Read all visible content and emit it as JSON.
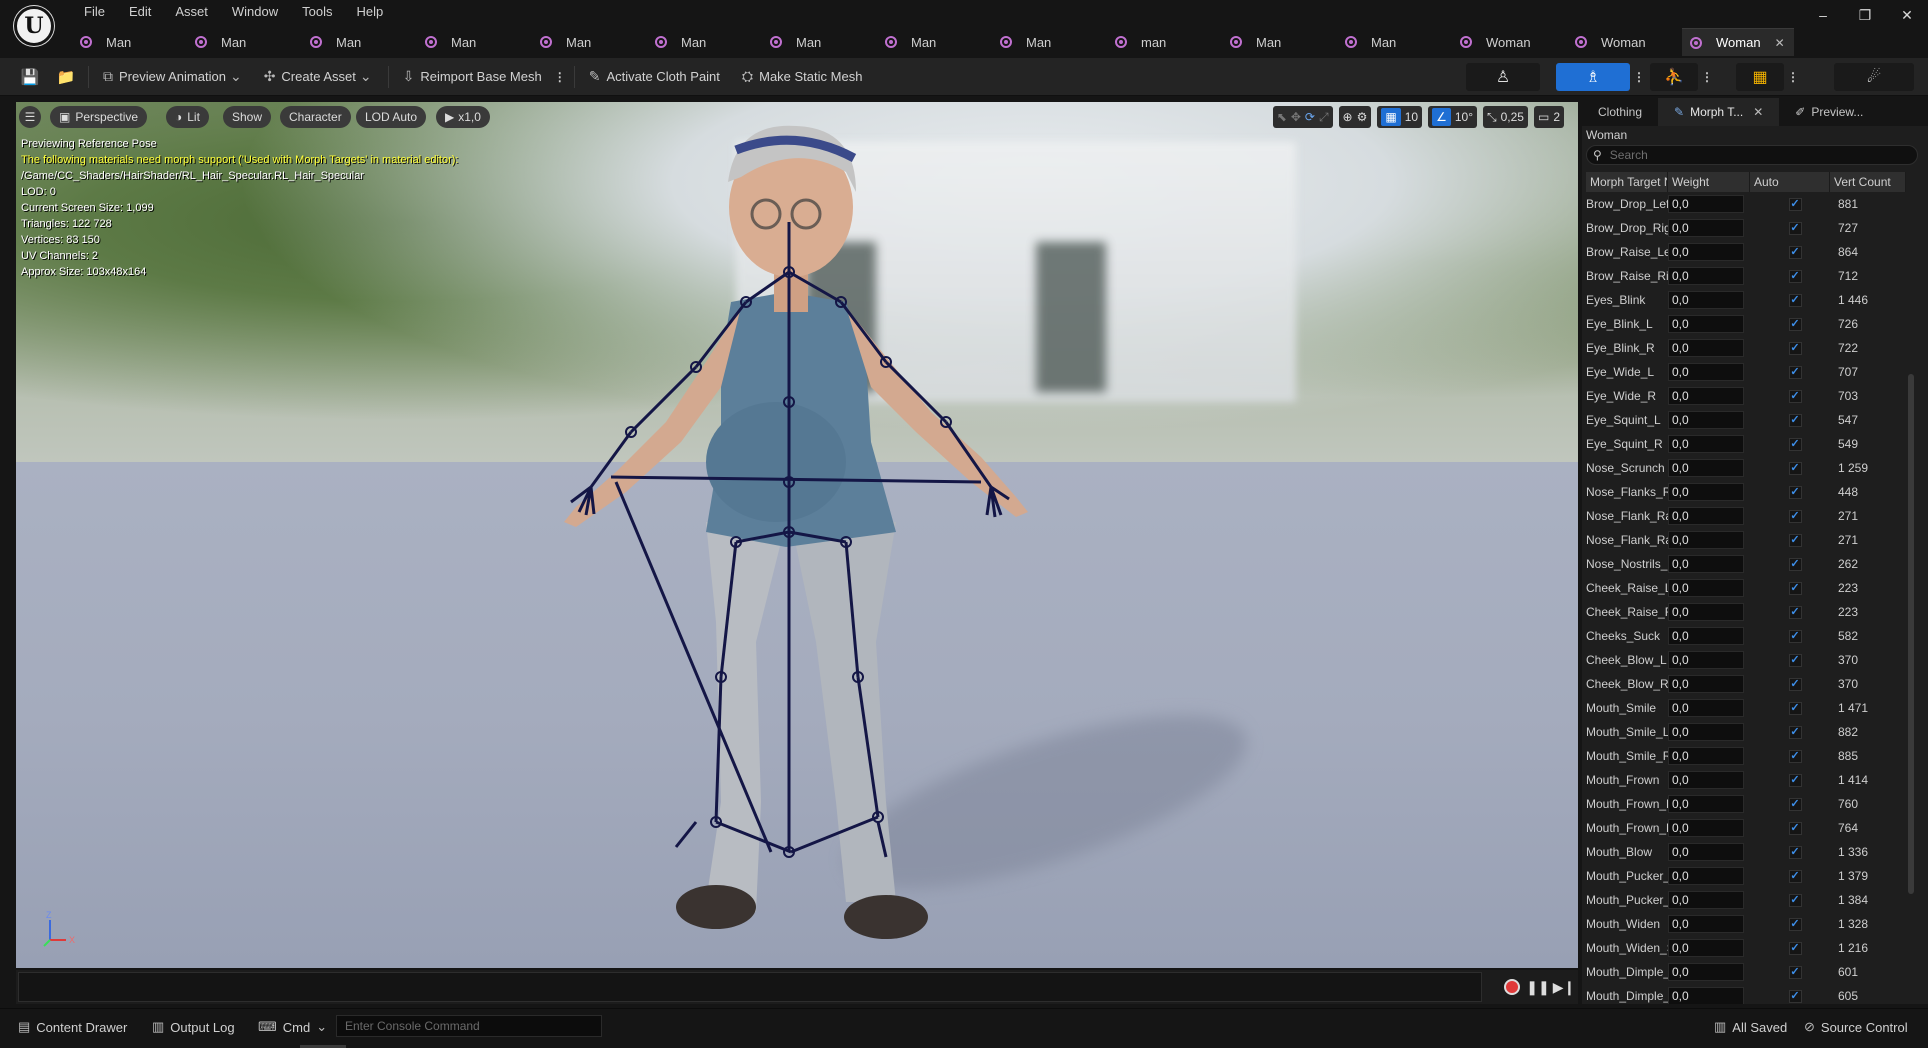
{
  "menu": [
    "File",
    "Edit",
    "Asset",
    "Window",
    "Tools",
    "Help"
  ],
  "window_controls": {
    "minimize": "–",
    "restore": "❐",
    "close": "✕"
  },
  "tabs": [
    {
      "label": "Man"
    },
    {
      "label": "Man"
    },
    {
      "label": "Man"
    },
    {
      "label": "Man"
    },
    {
      "label": "Man"
    },
    {
      "label": "Man"
    },
    {
      "label": "Man"
    },
    {
      "label": "Man"
    },
    {
      "label": "Man"
    },
    {
      "label": "man"
    },
    {
      "label": "Man"
    },
    {
      "label": "Man"
    },
    {
      "label": "Woman"
    },
    {
      "label": "Woman"
    },
    {
      "label": "Woman",
      "active": true
    }
  ],
  "toolbar": {
    "preview_animation": "Preview Animation",
    "create_asset": "Create Asset",
    "reimport": "Reimport Base Mesh",
    "cloth_paint": "Activate Cloth Paint",
    "static_mesh": "Make Static Mesh"
  },
  "viewport": {
    "perspective": "Perspective",
    "lit": "Lit",
    "show": "Show",
    "character": "Character",
    "lod": "LOD Auto",
    "speed": "x1,0",
    "grid_size": "10",
    "angle": "10°",
    "scale": "0,25",
    "camera_speed": "2",
    "info": {
      "line1": "Previewing Reference Pose",
      "warning": "The following materials need morph support ('Used with Morph Targets' in material editor):",
      "material": "/Game/CC_Shaders/HairShader/RL_Hair_Specular.RL_Hair_Specular",
      "lod": "LOD: 0",
      "screen_size": "Current Screen Size: 1,099",
      "triangles": "Triangles: 122 728",
      "vertices": "Vertices: 83 150",
      "uv": "UV Channels: 2",
      "approx": "Approx Size: 103x48x164"
    },
    "axis_z": "Z",
    "axis_x": "X"
  },
  "panel": {
    "tabs": {
      "clothing": "Clothing",
      "morph": "Morph T...",
      "preview": "Preview..."
    },
    "subject": "Woman",
    "search_placeholder": "Search",
    "columns": {
      "name": "Morph Target Name",
      "weight": "Weight",
      "auto": "Auto",
      "vert": "Vert Count"
    },
    "rows": [
      {
        "name": "Brow_Drop_Left",
        "weight": "0,0",
        "vert": "881"
      },
      {
        "name": "Brow_Drop_Right",
        "weight": "0,0",
        "vert": "727"
      },
      {
        "name": "Brow_Raise_Left",
        "weight": "0,0",
        "vert": "864"
      },
      {
        "name": "Brow_Raise_Right",
        "weight": "0,0",
        "vert": "712"
      },
      {
        "name": "Eyes_Blink",
        "weight": "0,0",
        "vert": "1 446"
      },
      {
        "name": "Eye_Blink_L",
        "weight": "0,0",
        "vert": "726"
      },
      {
        "name": "Eye_Blink_R",
        "weight": "0,0",
        "vert": "722"
      },
      {
        "name": "Eye_Wide_L",
        "weight": "0,0",
        "vert": "707"
      },
      {
        "name": "Eye_Wide_R",
        "weight": "0,0",
        "vert": "703"
      },
      {
        "name": "Eye_Squint_L",
        "weight": "0,0",
        "vert": "547"
      },
      {
        "name": "Eye_Squint_R",
        "weight": "0,0",
        "vert": "549"
      },
      {
        "name": "Nose_Scrunch",
        "weight": "0,0",
        "vert": "1 259"
      },
      {
        "name": "Nose_Flanks_Raise",
        "weight": "0,0",
        "vert": "448"
      },
      {
        "name": "Nose_Flank_Raise_L",
        "weight": "0,0",
        "vert": "271"
      },
      {
        "name": "Nose_Flank_Raise_R",
        "weight": "0,0",
        "vert": "271"
      },
      {
        "name": "Nose_Nostrils_Flare",
        "weight": "0,0",
        "vert": "262"
      },
      {
        "name": "Cheek_Raise_L",
        "weight": "0,0",
        "vert": "223"
      },
      {
        "name": "Cheek_Raise_R",
        "weight": "0,0",
        "vert": "223"
      },
      {
        "name": "Cheeks_Suck",
        "weight": "0,0",
        "vert": "582"
      },
      {
        "name": "Cheek_Blow_L",
        "weight": "0,0",
        "vert": "370"
      },
      {
        "name": "Cheek_Blow_R",
        "weight": "0,0",
        "vert": "370"
      },
      {
        "name": "Mouth_Smile",
        "weight": "0,0",
        "vert": "1 471"
      },
      {
        "name": "Mouth_Smile_L",
        "weight": "0,0",
        "vert": "882"
      },
      {
        "name": "Mouth_Smile_R",
        "weight": "0,0",
        "vert": "885"
      },
      {
        "name": "Mouth_Frown",
        "weight": "0,0",
        "vert": "1 414"
      },
      {
        "name": "Mouth_Frown_L",
        "weight": "0,0",
        "vert": "760"
      },
      {
        "name": "Mouth_Frown_R",
        "weight": "0,0",
        "vert": "764"
      },
      {
        "name": "Mouth_Blow",
        "weight": "0,0",
        "vert": "1 336"
      },
      {
        "name": "Mouth_Pucker_Up",
        "weight": "0,0",
        "vert": "1 379"
      },
      {
        "name": "Mouth_Pucker_Down",
        "weight": "0,0",
        "vert": "1 384"
      },
      {
        "name": "Mouth_Widen",
        "weight": "0,0",
        "vert": "1 328"
      },
      {
        "name": "Mouth_Widen_Sides",
        "weight": "0,0",
        "vert": "1 216"
      },
      {
        "name": "Mouth_Dimple_L",
        "weight": "0,0",
        "vert": "601"
      },
      {
        "name": "Mouth_Dimple_R",
        "weight": "0,0",
        "vert": "605"
      }
    ]
  },
  "statusbar": {
    "content_drawer": "Content Drawer",
    "output_log": "Output Log",
    "cmd": "Cmd",
    "console_placeholder": "Enter Console Command",
    "saved": "All Saved",
    "source_control": "Source Control"
  },
  "colors": {
    "accent": "#1f6fd4",
    "warning_text": "#ffff3a",
    "tab_icon": "#c070d0"
  }
}
